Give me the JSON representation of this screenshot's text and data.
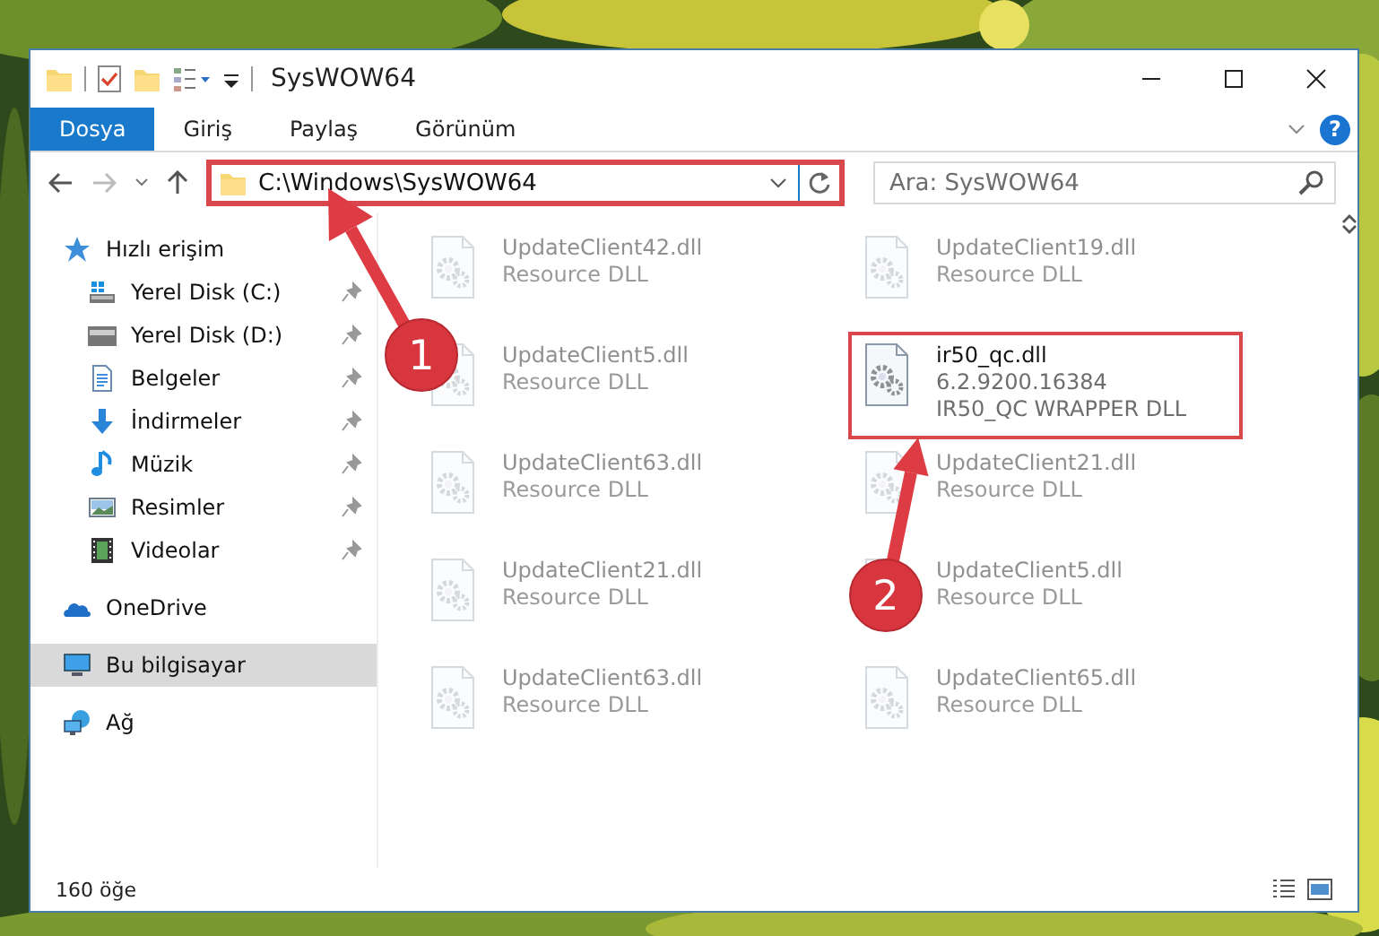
{
  "window": {
    "title": "SysWOW64"
  },
  "ribbon_tabs": [
    {
      "label": "Dosya",
      "selected": true
    },
    {
      "label": "Giriş",
      "selected": false
    },
    {
      "label": "Paylaş",
      "selected": false
    },
    {
      "label": "Görünüm",
      "selected": false
    }
  ],
  "ribbon_help": {
    "label": "?"
  },
  "address_bar": {
    "path": "C:\\Windows\\SysWOW64",
    "highlighted": true
  },
  "search": {
    "placeholder": "Ara: SysWOW64"
  },
  "sidebar": {
    "items": [
      {
        "label": "Hızlı erişim",
        "kind": "star",
        "selected": false,
        "children": [
          {
            "label": "Yerel Disk (C:)",
            "kind": "system-drive",
            "pinned": true,
            "selected": false
          },
          {
            "label": "Yerel Disk (D:)",
            "kind": "drive",
            "pinned": true,
            "selected": false
          },
          {
            "label": "Belgeler",
            "kind": "document",
            "pinned": true,
            "selected": false
          },
          {
            "label": "İndirmeler",
            "kind": "download",
            "pinned": true,
            "selected": false
          },
          {
            "label": "Müzik",
            "kind": "music",
            "pinned": true,
            "selected": false
          },
          {
            "label": "Resimler",
            "kind": "pictures",
            "pinned": true,
            "selected": false
          },
          {
            "label": "Videolar",
            "kind": "video",
            "pinned": true,
            "selected": false
          }
        ]
      },
      {
        "label": "OneDrive",
        "kind": "cloud",
        "selected": false
      },
      {
        "label": "Bu bilgisayar",
        "kind": "computer",
        "selected": true
      },
      {
        "label": "Ağ",
        "kind": "network",
        "selected": false
      }
    ]
  },
  "files": [
    {
      "name": "UpdateClient42.dll",
      "details": [
        "Resource DLL"
      ],
      "faded": true,
      "highlighted": false
    },
    {
      "name": "UpdateClient19.dll",
      "details": [
        "Resource DLL"
      ],
      "faded": true,
      "highlighted": false
    },
    {
      "name": "UpdateClient5.dll",
      "details": [
        "Resource DLL"
      ],
      "faded": true,
      "highlighted": false
    },
    {
      "name": "ir50_qc.dll",
      "details": [
        "6.2.9200.16384",
        "IR50_QC WRAPPER DLL"
      ],
      "faded": false,
      "highlighted": true
    },
    {
      "name": "UpdateClient63.dll",
      "details": [
        "Resource DLL"
      ],
      "faded": true,
      "highlighted": false
    },
    {
      "name": "UpdateClient21.dll",
      "details": [
        "Resource DLL"
      ],
      "faded": true,
      "highlighted": false
    },
    {
      "name": "UpdateClient21.dll",
      "details": [
        "Resource DLL"
      ],
      "faded": true,
      "highlighted": false
    },
    {
      "name": "UpdateClient5.dll",
      "details": [
        "Resource DLL"
      ],
      "faded": true,
      "highlighted": false
    },
    {
      "name": "UpdateClient63.dll",
      "details": [
        "Resource DLL"
      ],
      "faded": true,
      "highlighted": false
    },
    {
      "name": "UpdateClient65.dll",
      "details": [
        "Resource DLL"
      ],
      "faded": true,
      "highlighted": false
    }
  ],
  "annotations": [
    {
      "number": "1"
    },
    {
      "number": "2"
    }
  ],
  "status_bar": {
    "item_count": "160 öğe"
  }
}
